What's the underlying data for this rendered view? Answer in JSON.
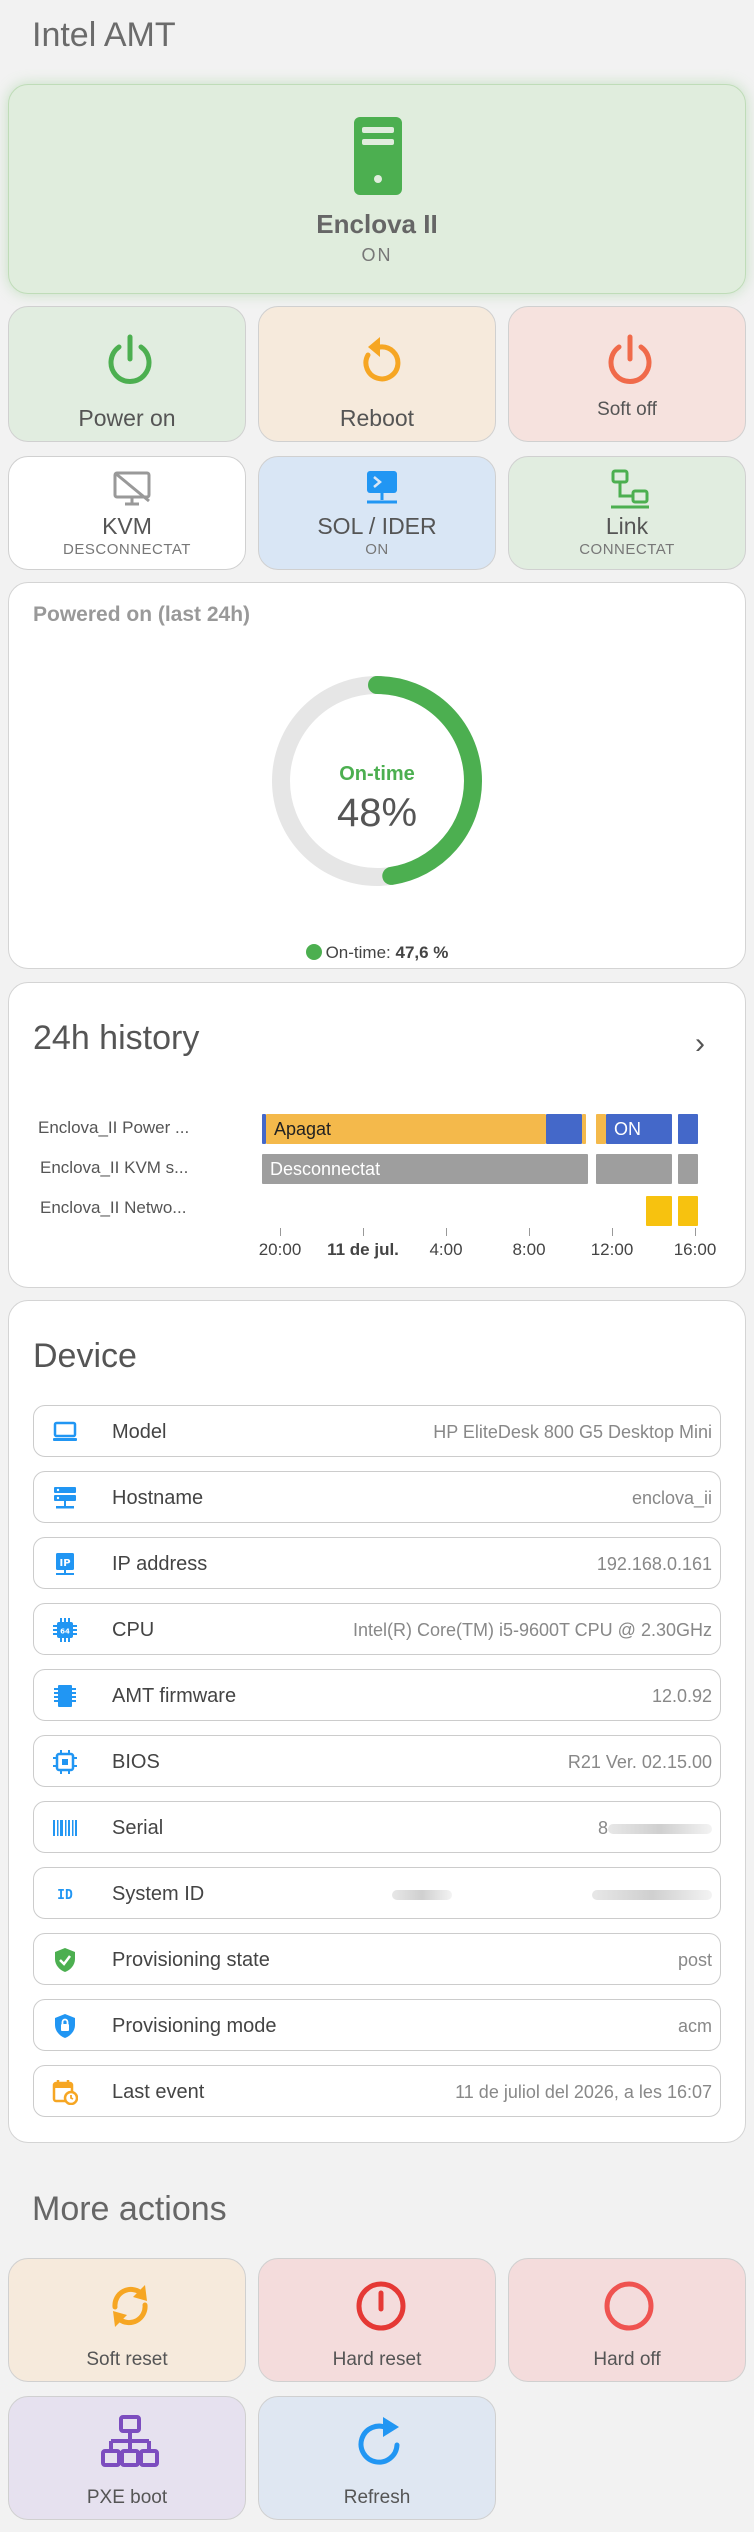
{
  "page_title": "Intel AMT",
  "hero": {
    "name": "Enclova II",
    "state": "ON"
  },
  "power_tiles": [
    {
      "label": "Power on"
    },
    {
      "label": "Reboot"
    },
    {
      "label": "Soft off"
    }
  ],
  "status_tiles": [
    {
      "label": "KVM",
      "sub": "DESCONNECTAT"
    },
    {
      "label": "SOL / IDER",
      "sub": "ON"
    },
    {
      "label": "Link",
      "sub": "CONNECTAT"
    }
  ],
  "uptime": {
    "title": "Powered on (last 24h)",
    "center_label": "On-time",
    "center_value": "48%",
    "legend_label": "On-time:",
    "legend_value": "47,6 %",
    "fraction": 0.476
  },
  "history": {
    "title": "24h history",
    "rows": [
      {
        "label": "Enclova_II Power ...",
        "segments": [
          {
            "text": "Apagat"
          },
          {
            "text": "ON"
          }
        ]
      },
      {
        "label": "Enclova_II KVM s...",
        "segments": [
          {
            "text": "Desconnectat"
          }
        ]
      },
      {
        "label": "Enclova_II Netwo..."
      }
    ],
    "axis": [
      "20:00",
      "11 de jul.",
      "4:00",
      "8:00",
      "12:00",
      "16:00"
    ]
  },
  "device": {
    "title": "Device",
    "rows": [
      {
        "label": "Model",
        "value": "HP EliteDesk 800 G5 Desktop Mini",
        "icon": "laptop-icon"
      },
      {
        "label": "Hostname",
        "value": "enclova_ii",
        "icon": "server-icon"
      },
      {
        "label": "IP address",
        "value": "192.168.0.161",
        "icon": "ip-icon"
      },
      {
        "label": "CPU",
        "value": "Intel(R) Core(TM) i5-9600T CPU @ 2.30GHz",
        "icon": "cpu-icon"
      },
      {
        "label": "AMT firmware",
        "value": "12.0.92",
        "icon": "memory-icon"
      },
      {
        "label": "BIOS",
        "value": "R21 Ver. 02.15.00",
        "icon": "chip-icon"
      },
      {
        "label": "Serial",
        "value": "8",
        "icon": "barcode-icon"
      },
      {
        "label": "System ID",
        "value": "",
        "icon": "id-icon"
      },
      {
        "label": "Provisioning state",
        "value": "post",
        "icon": "shield-check-icon"
      },
      {
        "label": "Provisioning mode",
        "value": "acm",
        "icon": "shield-lock-icon"
      },
      {
        "label": "Last event",
        "value": "11 de juliol del 2026, a les 16:07",
        "icon": "calendar-clock-icon"
      }
    ]
  },
  "more_actions": {
    "title": "More actions",
    "tiles": [
      {
        "label": "Soft reset"
      },
      {
        "label": "Hard reset"
      },
      {
        "label": "Hard off"
      },
      {
        "label": "PXE boot"
      },
      {
        "label": "Refresh"
      }
    ]
  },
  "colors": {
    "green": "#4caf50",
    "orange": "#f6a623",
    "red": "#f06a4a",
    "blue": "#2196f3",
    "purple": "#7c4dbf",
    "segment_off": "#f4b94b",
    "segment_on": "#4468c9",
    "segment_gray": "#9e9e9e",
    "segment_yellow": "#f7c20f"
  }
}
